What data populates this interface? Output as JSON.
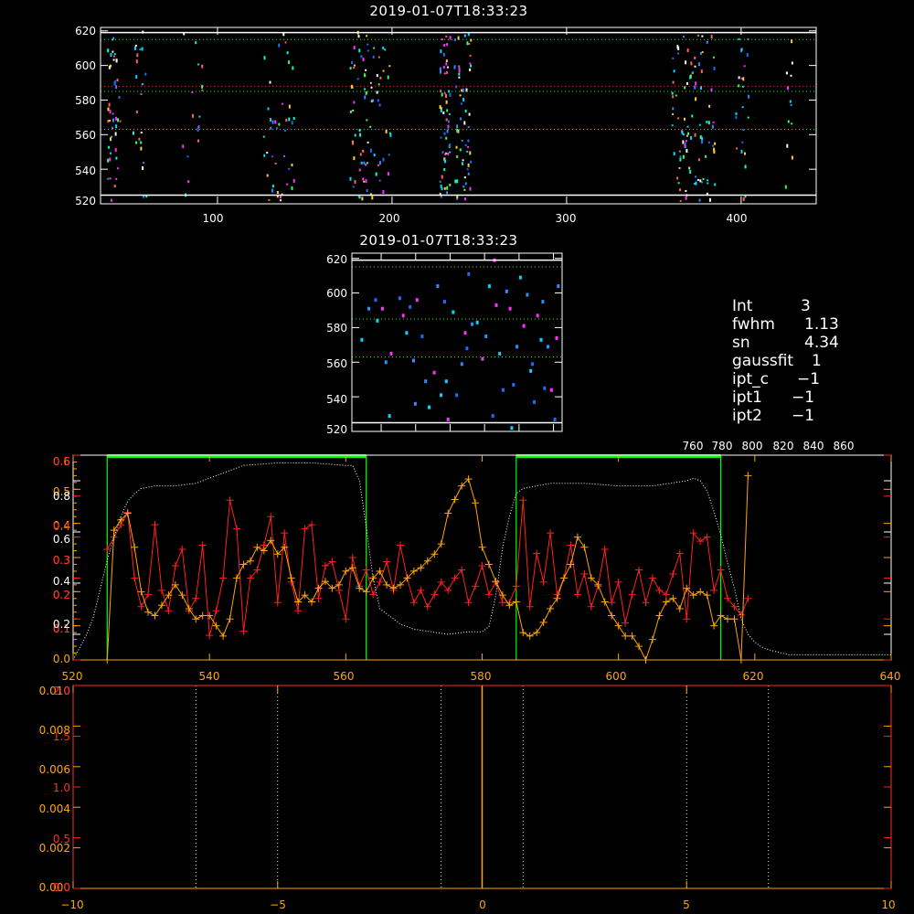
{
  "chart_data": [
    {
      "type": "scatter",
      "title": "2019-01-07T18:33:23",
      "xlim": [
        33,
        443
      ],
      "ylim": [
        520,
        622
      ],
      "x_ticks": [
        100,
        200,
        300,
        400
      ],
      "y_ticks": [
        520,
        540,
        560,
        580,
        600,
        620
      ],
      "hlines_white": [
        525,
        619
      ],
      "hlines_green_dotted": [
        563,
        585,
        615
      ],
      "hlines_red_dotted": [
        588
      ],
      "bright_columns": [
        {
          "x_center": 40,
          "width": 8,
          "count": 45
        },
        {
          "x_center": 55,
          "width": 8,
          "count": 22
        },
        {
          "x_center": 85,
          "width": 12,
          "count": 16
        },
        {
          "x_center": 135,
          "width": 18,
          "count": 42
        },
        {
          "x_center": 180,
          "width": 10,
          "count": 46
        },
        {
          "x_center": 192,
          "width": 14,
          "count": 40
        },
        {
          "x_center": 230,
          "width": 6,
          "count": 55
        },
        {
          "x_center": 240,
          "width": 10,
          "count": 60
        },
        {
          "x_center": 365,
          "width": 12,
          "count": 50
        },
        {
          "x_center": 378,
          "width": 14,
          "count": 50
        },
        {
          "x_center": 400,
          "width": 8,
          "count": 24
        },
        {
          "x_center": 428,
          "width": 6,
          "count": 12
        }
      ]
    },
    {
      "type": "scatter",
      "title": "2019-01-07T18:33:23",
      "xlim": [
        743,
        865
      ],
      "ylim": [
        520,
        623
      ],
      "x_ticks": [
        760,
        780,
        800,
        820,
        840,
        860
      ],
      "y_ticks": [
        520,
        540,
        560,
        580,
        600,
        620
      ],
      "hlines_white": [
        525,
        619
      ],
      "hlines_green_dotted": [
        563,
        585,
        615
      ],
      "points": [
        [
          756,
          597
        ],
        [
          752,
          592
        ],
        [
          748,
          574
        ],
        [
          760,
          592
        ],
        [
          762,
          561
        ],
        [
          764,
          530
        ],
        [
          770,
          598
        ],
        [
          772,
          588
        ],
        [
          774,
          578
        ],
        [
          776,
          593
        ],
        [
          778,
          562
        ],
        [
          780,
          597
        ],
        [
          783,
          576
        ],
        [
          785,
          550
        ],
        [
          787,
          535
        ],
        [
          790,
          555
        ],
        [
          792,
          605
        ],
        [
          794,
          542
        ],
        [
          796,
          596
        ],
        [
          798,
          528
        ],
        [
          801,
          590
        ],
        [
          803,
          542
        ],
        [
          806,
          560
        ],
        [
          808,
          578
        ],
        [
          810,
          612
        ],
        [
          812,
          583
        ],
        [
          815,
          584
        ],
        [
          818,
          563
        ],
        [
          820,
          576
        ],
        [
          822,
          605
        ],
        [
          824,
          530
        ],
        [
          826,
          594
        ],
        [
          828,
          566
        ],
        [
          830,
          545
        ],
        [
          832,
          602
        ],
        [
          834,
          592
        ],
        [
          836,
          548
        ],
        [
          838,
          570
        ],
        [
          840,
          610
        ],
        [
          842,
          582
        ],
        [
          844,
          600
        ],
        [
          846,
          556
        ],
        [
          848,
          538
        ],
        [
          850,
          588
        ],
        [
          852,
          574
        ],
        [
          854,
          546
        ],
        [
          856,
          570
        ],
        [
          858,
          545
        ],
        [
          860,
          528
        ],
        [
          862,
          605
        ],
        [
          757,
          585
        ],
        [
          765,
          566
        ],
        [
          779,
          537
        ],
        [
          797,
          550
        ],
        [
          809,
          569
        ],
        [
          825,
          620
        ],
        [
          835,
          523
        ],
        [
          847,
          560
        ],
        [
          853,
          596
        ],
        [
          861,
          575
        ]
      ]
    },
    {
      "type": "line",
      "xlim": [
        520,
        640
      ],
      "x_ticks": [
        520,
        540,
        560,
        580,
        600,
        620,
        640
      ],
      "left_axis_orange": {
        "ylim": [
          0,
          0.6
        ],
        "ticks": [
          0.0,
          0.1,
          0.2,
          0.3,
          0.4,
          0.5,
          0.6
        ]
      },
      "left_axis_red": {
        "ylim": [
          0,
          0.5
        ],
        "ticks": [
          0.0,
          0.1,
          0.2,
          0.3,
          0.4,
          0.5
        ]
      },
      "left_axis_white": {
        "ylim": [
          0.1,
          0.9
        ],
        "ticks": [
          0.2,
          0.4,
          0.6,
          0.8
        ]
      },
      "vlines_green": [
        525,
        563,
        585,
        615
      ],
      "top_bars_green": [
        [
          525,
          563
        ],
        [
          585,
          615
        ]
      ],
      "series": [
        {
          "color": "red",
          "ylim": [
            0,
            0.5
          ],
          "x": [
            525,
            526,
            527,
            528,
            529,
            530,
            531,
            532,
            533,
            534,
            535,
            536,
            537,
            538,
            539,
            540,
            541,
            542,
            543,
            544,
            545,
            546,
            547,
            548,
            549,
            550,
            551,
            552,
            553,
            554,
            555,
            556,
            557,
            558,
            559,
            560,
            561,
            562,
            563,
            564,
            565,
            566,
            567,
            568,
            569,
            570,
            571,
            572,
            573,
            574,
            575,
            576,
            577,
            578,
            579,
            580,
            581,
            582,
            583,
            584,
            585,
            586,
            587,
            588,
            589,
            590,
            591,
            592,
            593,
            594,
            595,
            596,
            597,
            598,
            599,
            600,
            601,
            602,
            603,
            604,
            605,
            606,
            607,
            608,
            609,
            610,
            611,
            612,
            613,
            614,
            615,
            616,
            617,
            618,
            619
          ],
          "values": [
            0.27,
            0.3,
            0.33,
            0.36,
            0.2,
            0.13,
            0.16,
            0.33,
            0.17,
            0.12,
            0.23,
            0.27,
            0.12,
            0.15,
            0.28,
            0.06,
            0.12,
            0.2,
            0.39,
            0.32,
            0.07,
            0.2,
            0.22,
            0.28,
            0.35,
            0.14,
            0.31,
            0.19,
            0.12,
            0.32,
            0.33,
            0.15,
            0.23,
            0.24,
            0.17,
            0.1,
            0.25,
            0.18,
            0.22,
            0.16,
            0.19,
            0.24,
            0.17,
            0.28,
            0.2,
            0.14,
            0.17,
            0.13,
            0.16,
            0.19,
            0.17,
            0.2,
            0.22,
            0.14,
            0.18,
            0.23,
            0.16,
            0.19,
            0.14,
            0.14,
            0.18,
            0.39,
            0.13,
            0.26,
            0.19,
            0.31,
            0.16,
            0.2,
            0.28,
            0.16,
            0.21,
            0.13,
            0.18,
            0.27,
            0.14,
            0.19,
            0.09,
            0.16,
            0.22,
            0.14,
            0.2,
            0.17,
            0.16,
            0.21,
            0.26,
            0.1,
            0.31,
            0.29,
            0.3,
            0.17,
            0.22,
            0.15,
            0.13,
            0.11,
            0.15
          ]
        },
        {
          "color": "orange",
          "ylim": [
            0,
            0.6
          ],
          "x": [
            525,
            526,
            527,
            528,
            529,
            530,
            531,
            532,
            533,
            534,
            535,
            536,
            537,
            538,
            539,
            540,
            541,
            542,
            543,
            544,
            545,
            546,
            547,
            548,
            549,
            550,
            551,
            552,
            553,
            554,
            555,
            556,
            557,
            558,
            559,
            560,
            561,
            562,
            563,
            564,
            565,
            566,
            567,
            568,
            569,
            570,
            571,
            572,
            573,
            574,
            575,
            576,
            577,
            578,
            579,
            580,
            581,
            582,
            583,
            584,
            585,
            586,
            587,
            588,
            589,
            590,
            591,
            592,
            593,
            594,
            595,
            596,
            597,
            598,
            599,
            600,
            601,
            602,
            603,
            604,
            605,
            606,
            607,
            608,
            609,
            610,
            611,
            612,
            613,
            614,
            615,
            616,
            617,
            618,
            619
          ],
          "values": [
            0.0,
            0.38,
            0.41,
            0.43,
            0.33,
            0.2,
            0.14,
            0.13,
            0.16,
            0.19,
            0.22,
            0.19,
            0.15,
            0.12,
            0.13,
            0.13,
            0.1,
            0.07,
            0.12,
            0.24,
            0.28,
            0.29,
            0.33,
            0.32,
            0.35,
            0.31,
            0.33,
            0.24,
            0.17,
            0.19,
            0.17,
            0.21,
            0.23,
            0.21,
            0.22,
            0.26,
            0.27,
            0.21,
            0.2,
            0.24,
            0.26,
            0.22,
            0.21,
            0.22,
            0.24,
            0.26,
            0.27,
            0.29,
            0.31,
            0.34,
            0.43,
            0.47,
            0.51,
            0.53,
            0.46,
            0.33,
            0.28,
            0.23,
            0.19,
            0.16,
            0.17,
            0.08,
            0.07,
            0.08,
            0.11,
            0.15,
            0.18,
            0.24,
            0.28,
            0.36,
            0.33,
            0.24,
            0.22,
            0.17,
            0.13,
            0.1,
            0.07,
            0.07,
            0.04,
            0.0,
            0.06,
            0.13,
            0.17,
            0.18,
            0.15,
            0.21,
            0.19,
            0.2,
            0.19,
            0.1,
            0.13,
            0.12,
            0.12,
            0.0,
            0.54
          ]
        },
        {
          "color": "white",
          "ylim": [
            0.1,
            0.9
          ],
          "style": "dotted",
          "x": [
            520,
            522,
            523,
            524,
            525,
            526,
            527,
            528,
            529,
            530,
            532,
            535,
            538,
            540,
            543,
            545,
            550,
            555,
            560,
            561,
            562,
            563,
            564,
            565,
            568,
            570,
            575,
            578,
            580,
            581,
            582,
            583,
            584,
            585,
            586,
            588,
            590,
            595,
            600,
            605,
            610,
            611,
            612,
            613,
            614,
            615,
            616,
            617,
            618,
            619,
            620,
            621,
            622,
            625,
            630,
            635,
            640
          ],
          "values": [
            0.1,
            0.2,
            0.27,
            0.38,
            0.49,
            0.58,
            0.66,
            0.72,
            0.75,
            0.77,
            0.78,
            0.78,
            0.79,
            0.81,
            0.84,
            0.86,
            0.87,
            0.87,
            0.86,
            0.86,
            0.8,
            0.62,
            0.42,
            0.3,
            0.24,
            0.22,
            0.2,
            0.21,
            0.21,
            0.23,
            0.35,
            0.54,
            0.66,
            0.75,
            0.77,
            0.78,
            0.79,
            0.79,
            0.78,
            0.78,
            0.8,
            0.81,
            0.8,
            0.76,
            0.68,
            0.59,
            0.48,
            0.38,
            0.26,
            0.2,
            0.17,
            0.15,
            0.14,
            0.12,
            0.12,
            0.12,
            0.12
          ]
        }
      ]
    },
    {
      "type": "line",
      "xlim": [
        -10,
        10
      ],
      "x_ticks": [
        -10,
        -5,
        0,
        5,
        10
      ],
      "left_axis_orange": {
        "ylim": [
          0,
          0.01
        ],
        "ticks": [
          0.0,
          0.002,
          0.004,
          0.006,
          0.008,
          0.01
        ]
      },
      "left_axis_red": {
        "ylim": [
          0,
          2.0
        ],
        "ticks": [
          0.0,
          0.5,
          1.0,
          1.5,
          2.0
        ]
      },
      "vlines_orange": [
        0
      ],
      "vlines_green_dotted": [
        -1,
        1
      ],
      "vlines_yellow_dotted": [
        -7,
        -5,
        5,
        7
      ],
      "series": []
    }
  ],
  "tick_labels": {
    "p1_x": [
      "100",
      "200",
      "300",
      "400"
    ],
    "p1_y": [
      "520",
      "540",
      "560",
      "580",
      "600",
      "620"
    ],
    "p2_x": [
      "760",
      "780",
      "800",
      "820",
      "840",
      "860"
    ],
    "p2_y": [
      "520",
      "540",
      "560",
      "580",
      "600",
      "620"
    ],
    "p3_x": [
      "520",
      "540",
      "560",
      "580",
      "600",
      "620",
      "640"
    ],
    "p3_y_orange": [
      "0.0",
      "0.1",
      "0.2",
      "0.3",
      "0.4",
      "0.5",
      "0.6"
    ],
    "p3_y_red": [
      "0.0",
      "0.1",
      "0.2",
      "0.3",
      "0.4",
      "0.5"
    ],
    "p3_y_white": [
      "0.2",
      "0.4",
      "0.6",
      "0.8"
    ],
    "p4_x": [
      "−10",
      "−5",
      "0",
      "5",
      "10"
    ],
    "p4_y_orange": [
      "0.000",
      "0.002",
      "0.004",
      "0.006",
      "0.008",
      "0.010"
    ],
    "p4_y_red": [
      "0.0",
      "0.5",
      "1.0",
      "1.5",
      "2.0"
    ]
  },
  "params": [
    {
      "key": "Int",
      "value": "3"
    },
    {
      "key": "fwhm",
      "value": "1.13"
    },
    {
      "key": "sn",
      "value": "4.34"
    },
    {
      "key": "gaussfit",
      "value": "1"
    },
    {
      "key": "ipt_c",
      "value": "−1"
    },
    {
      "key": "ipt1",
      "value": "−1"
    },
    {
      "key": "ipt2",
      "value": "−1"
    }
  ],
  "colors": {
    "background": "#000000",
    "axis": "#ffffff",
    "axis_bottom": "#ff2a2a",
    "green": "#00ff00",
    "red": "#ff2020",
    "orange": "#ffa500",
    "white_line": "#ffffff",
    "yellow": "#ffff66",
    "scatter_palette": [
      "#1e6bff",
      "#2f8cff",
      "#00d8ff",
      "#00ffcc",
      "#30ff60",
      "#ff30ff",
      "#ff6060",
      "#ffffff",
      "#ffcc33"
    ]
  }
}
